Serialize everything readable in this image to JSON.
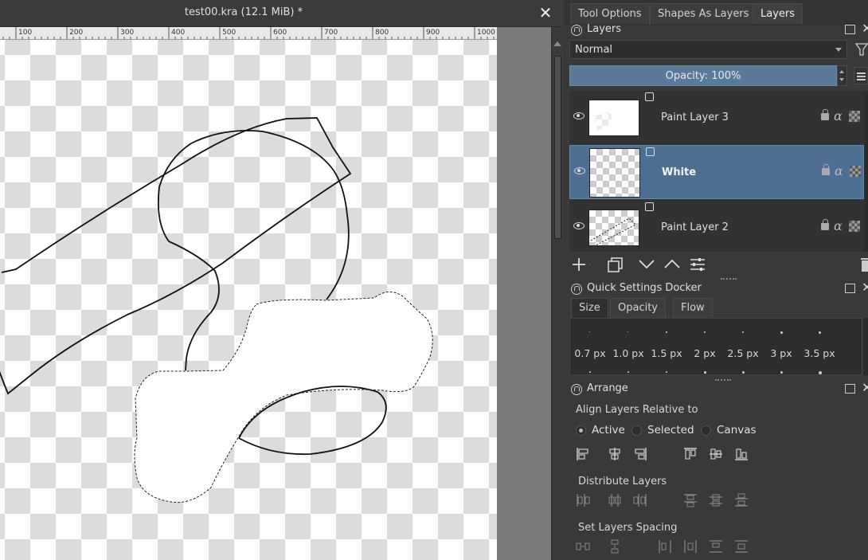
{
  "document": {
    "title": "test00.kra (12.1 MiB) *",
    "ruler_ticks": [
      "100",
      "200",
      "300",
      "400",
      "500",
      "600",
      "700",
      "800",
      "900",
      "1000"
    ]
  },
  "dock": {
    "tabs": [
      {
        "label": "Tool Options"
      },
      {
        "label": "Shapes As Layers"
      },
      {
        "label": "Layers"
      }
    ],
    "active_tab": "Layers"
  },
  "layers_panel": {
    "title": "Layers",
    "blend_mode": "Normal",
    "opacity_label": "Opacity:  100%",
    "layers": [
      {
        "name": "Paint Layer 3",
        "selected": false
      },
      {
        "name": "White",
        "selected": true
      },
      {
        "name": "Paint Layer 2",
        "selected": false
      }
    ]
  },
  "quick_settings": {
    "title": "Quick Settings Docker",
    "tabs": [
      {
        "label": "Size"
      },
      {
        "label": "Opacity"
      },
      {
        "label": "Flow"
      }
    ],
    "active_tab": "Size",
    "sizes": [
      "0.7 px",
      "1.0 px",
      "1.5 px",
      "2 px",
      "2.5 px",
      "3 px",
      "3.5 px"
    ]
  },
  "arrange": {
    "title": "Arrange",
    "align_label": "Align Layers Relative to",
    "options": [
      {
        "label": "Active",
        "checked": true
      },
      {
        "label": "Selected",
        "checked": false
      },
      {
        "label": "Canvas",
        "checked": false
      }
    ],
    "distribute_label": "Distribute Layers",
    "spacing_label": "Set Layers Spacing"
  },
  "colors": {
    "selection_blue": "#4d6f92",
    "opacity_bar": "#5a7a9a",
    "panel_bg": "#393939"
  }
}
